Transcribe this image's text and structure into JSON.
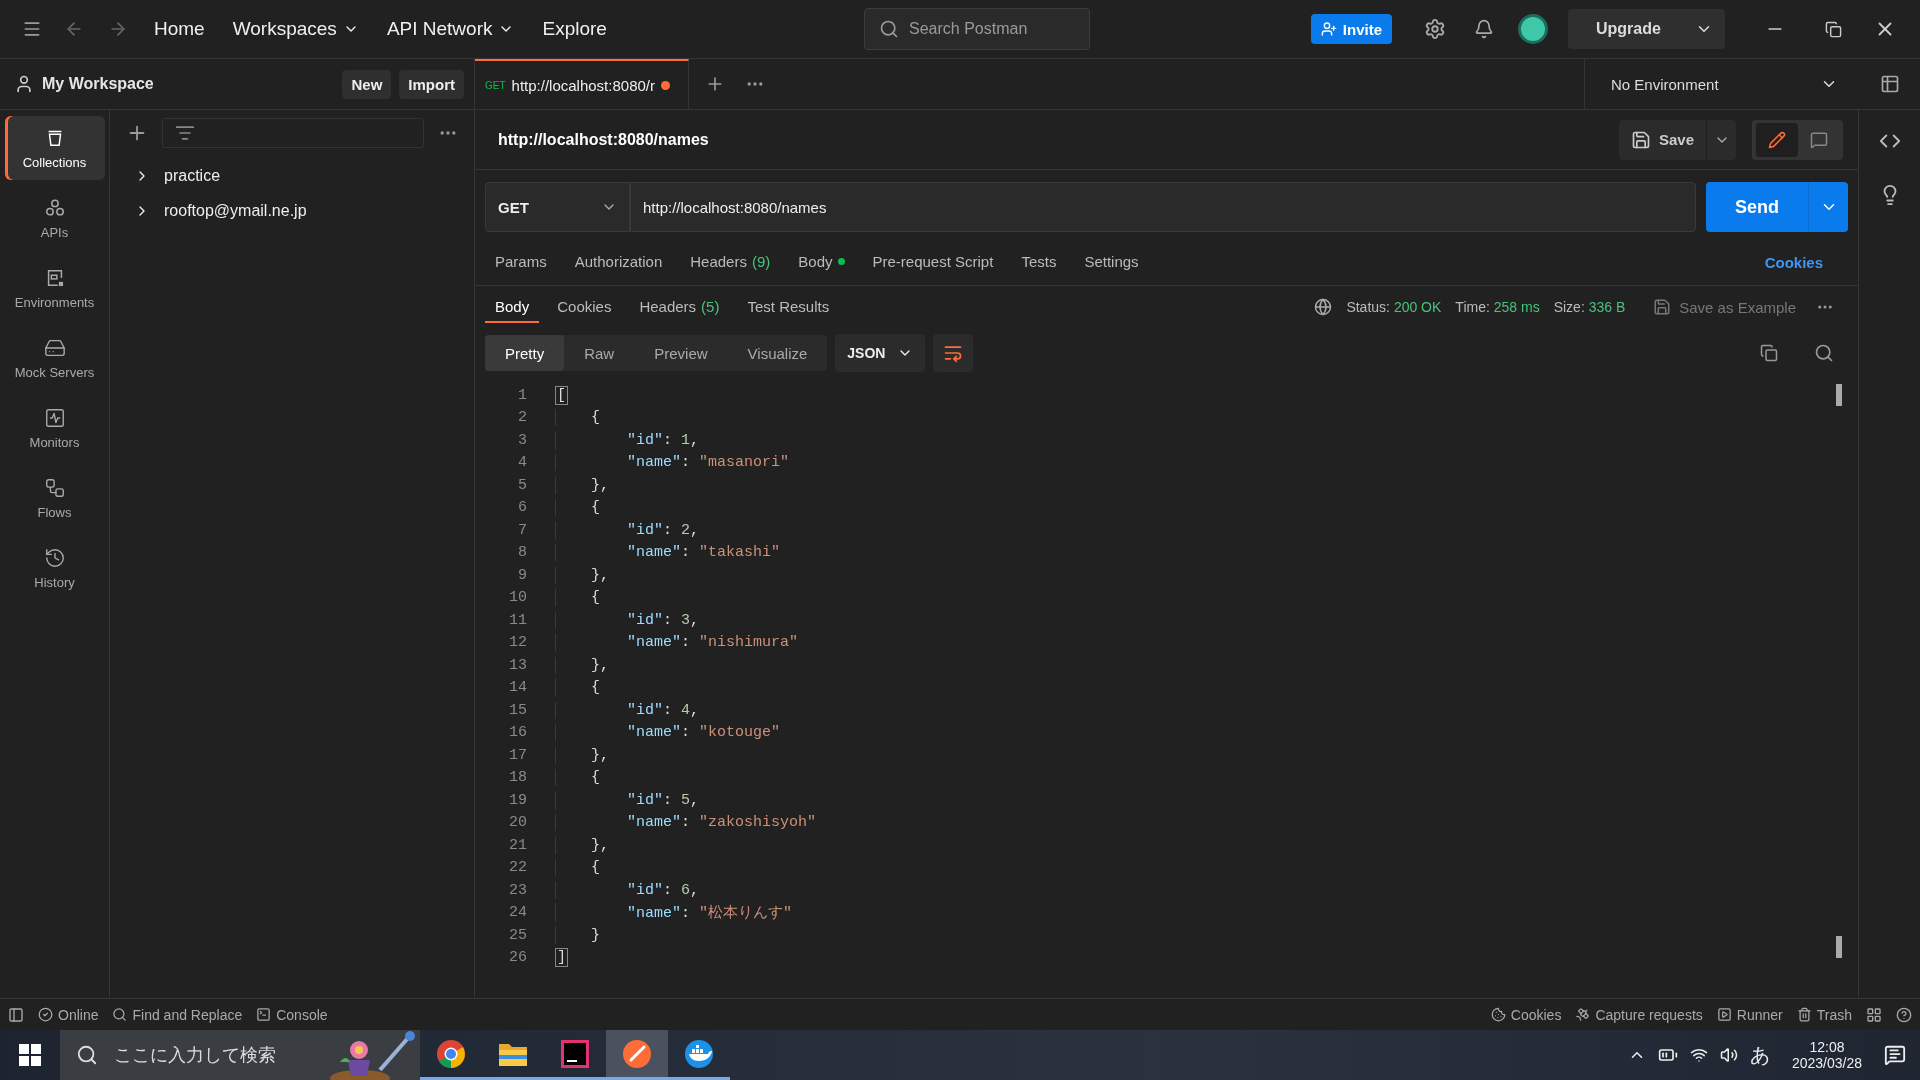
{
  "topbar": {
    "nav": [
      {
        "label": "Home",
        "dropdown": false
      },
      {
        "label": "Workspaces",
        "dropdown": true
      },
      {
        "label": "API Network",
        "dropdown": true
      },
      {
        "label": "Explore",
        "dropdown": false
      }
    ],
    "search_placeholder": "Search Postman",
    "invite": "Invite",
    "upgrade": "Upgrade"
  },
  "workspace": {
    "name": "My Workspace",
    "buttons": [
      "New",
      "Import"
    ]
  },
  "open_tabs": [
    {
      "method": "GET",
      "title": "http://localhost:8080/r",
      "unsaved": true,
      "selected": true
    }
  ],
  "environment": "No Environment",
  "rail": [
    {
      "kind": "collections",
      "label": "Collections",
      "selected": true
    },
    {
      "kind": "apis",
      "label": "APIs",
      "selected": false
    },
    {
      "kind": "environments",
      "label": "Environments",
      "selected": false
    },
    {
      "kind": "mock",
      "label": "Mock Servers",
      "selected": false
    },
    {
      "kind": "monitors",
      "label": "Monitors",
      "selected": false
    },
    {
      "kind": "flows",
      "label": "Flows",
      "selected": false
    },
    {
      "kind": "history",
      "label": "History",
      "selected": false
    }
  ],
  "collections": [
    {
      "name": "practice",
      "expanded": false
    },
    {
      "name": "rooftop@ymail.ne.jp",
      "expanded": false
    }
  ],
  "request": {
    "title": "http://localhost:8080/names",
    "save": "Save",
    "method": "GET",
    "url": "http://localhost:8080/names",
    "send": "Send",
    "modes": [
      {
        "kind": "edit",
        "selected": true
      },
      {
        "kind": "comments",
        "selected": false
      }
    ],
    "sections": [
      {
        "label": "Params",
        "selected": false
      },
      {
        "label": "Authorization",
        "selected": false
      },
      {
        "label": "Headers",
        "count": "(9)",
        "selected": false
      },
      {
        "label": "Body",
        "dot": true,
        "selected": false
      },
      {
        "label": "Pre-request Script",
        "selected": false
      },
      {
        "label": "Tests",
        "selected": false
      },
      {
        "label": "Settings",
        "selected": false
      }
    ],
    "cookies_link": "Cookies"
  },
  "response": {
    "tabs": [
      {
        "label": "Body",
        "selected": true
      },
      {
        "label": "Cookies",
        "selected": false
      },
      {
        "label": "Headers",
        "count": "(5)",
        "selected": false
      },
      {
        "label": "Test Results",
        "selected": false
      }
    ],
    "stats": [
      {
        "label": "Status:",
        "value": "200 OK"
      },
      {
        "label": "Time:",
        "value": "258 ms"
      },
      {
        "label": "Size:",
        "value": "336 B"
      }
    ],
    "save_example": {
      "label": "Save as Example",
      "disabled": true
    },
    "views": [
      {
        "label": "Pretty",
        "selected": true
      },
      {
        "label": "Raw",
        "selected": false
      },
      {
        "label": "Preview",
        "selected": false
      },
      {
        "label": "Visualize",
        "selected": false
      }
    ],
    "format": "JSON",
    "body": {
      "open": {
        "line": "1",
        "text": "[",
        "highlighted": true
      },
      "objects": [
        {
          "open": {
            "line": "2",
            "text": "{"
          },
          "fields": [
            {
              "line": "3",
              "tokens": [
                {
                  "kind": "key",
                  "text": "\"id\""
                },
                {
                  "kind": "colon",
                  "text": ":"
                },
                {
                  "kind": "number",
                  "text": "1"
                },
                {
                  "kind": "punct",
                  "text": ","
                }
              ]
            },
            {
              "line": "4",
              "tokens": [
                {
                  "kind": "key",
                  "text": "\"name\""
                },
                {
                  "kind": "colon",
                  "text": ":"
                },
                {
                  "kind": "string",
                  "text": "\"masanori\""
                }
              ]
            }
          ],
          "close": {
            "line": "5",
            "text": "},"
          }
        },
        {
          "open": {
            "line": "6",
            "text": "{"
          },
          "fields": [
            {
              "line": "7",
              "tokens": [
                {
                  "kind": "key",
                  "text": "\"id\""
                },
                {
                  "kind": "colon",
                  "text": ":"
                },
                {
                  "kind": "number",
                  "text": "2"
                },
                {
                  "kind": "punct",
                  "text": ","
                }
              ]
            },
            {
              "line": "8",
              "tokens": [
                {
                  "kind": "key",
                  "text": "\"name\""
                },
                {
                  "kind": "colon",
                  "text": ":"
                },
                {
                  "kind": "string",
                  "text": "\"takashi\""
                }
              ]
            }
          ],
          "close": {
            "line": "9",
            "text": "},"
          }
        },
        {
          "open": {
            "line": "10",
            "text": "{"
          },
          "fields": [
            {
              "line": "11",
              "tokens": [
                {
                  "kind": "key",
                  "text": "\"id\""
                },
                {
                  "kind": "colon",
                  "text": ":"
                },
                {
                  "kind": "number",
                  "text": "3"
                },
                {
                  "kind": "punct",
                  "text": ","
                }
              ]
            },
            {
              "line": "12",
              "tokens": [
                {
                  "kind": "key",
                  "text": "\"name\""
                },
                {
                  "kind": "colon",
                  "text": ":"
                },
                {
                  "kind": "string",
                  "text": "\"nishimura\""
                }
              ]
            }
          ],
          "close": {
            "line": "13",
            "text": "},"
          }
        },
        {
          "open": {
            "line": "14",
            "text": "{"
          },
          "fields": [
            {
              "line": "15",
              "tokens": [
                {
                  "kind": "key",
                  "text": "\"id\""
                },
                {
                  "kind": "colon",
                  "text": ":"
                },
                {
                  "kind": "number",
                  "text": "4"
                },
                {
                  "kind": "punct",
                  "text": ","
                }
              ]
            },
            {
              "line": "16",
              "tokens": [
                {
                  "kind": "key",
                  "text": "\"name\""
                },
                {
                  "kind": "colon",
                  "text": ":"
                },
                {
                  "kind": "string",
                  "text": "\"kotouge\""
                }
              ]
            }
          ],
          "close": {
            "line": "17",
            "text": "},"
          }
        },
        {
          "open": {
            "line": "18",
            "text": "{"
          },
          "fields": [
            {
              "line": "19",
              "tokens": [
                {
                  "kind": "key",
                  "text": "\"id\""
                },
                {
                  "kind": "colon",
                  "text": ":"
                },
                {
                  "kind": "number",
                  "text": "5"
                },
                {
                  "kind": "punct",
                  "text": ","
                }
              ]
            },
            {
              "line": "20",
              "tokens": [
                {
                  "kind": "key",
                  "text": "\"name\""
                },
                {
                  "kind": "colon",
                  "text": ":"
                },
                {
                  "kind": "string",
                  "text": "\"zakoshisyoh\""
                }
              ]
            }
          ],
          "close": {
            "line": "21",
            "text": "},"
          }
        },
        {
          "open": {
            "line": "22",
            "text": "{"
          },
          "fields": [
            {
              "line": "23",
              "tokens": [
                {
                  "kind": "key",
                  "text": "\"id\""
                },
                {
                  "kind": "colon",
                  "text": ":"
                },
                {
                  "kind": "number",
                  "text": "6"
                },
                {
                  "kind": "punct",
                  "text": ","
                }
              ]
            },
            {
              "line": "24",
              "tokens": [
                {
                  "kind": "key",
                  "text": "\"name\""
                },
                {
                  "kind": "colon",
                  "text": ":"
                },
                {
                  "kind": "string",
                  "text": "\"松本りんす\""
                }
              ]
            }
          ],
          "close": {
            "line": "25",
            "text": "}"
          }
        }
      ],
      "close": {
        "line": "26",
        "text": "]",
        "highlighted": true
      }
    }
  },
  "status_bar": {
    "left": [
      {
        "kind": "online",
        "label": "Online"
      },
      {
        "kind": "find",
        "label": "Find and Replace"
      },
      {
        "kind": "console",
        "label": "Console"
      }
    ],
    "right": [
      {
        "kind": "cookies",
        "label": "Cookies"
      },
      {
        "kind": "capture",
        "label": "Capture requests"
      },
      {
        "kind": "runner",
        "label": "Runner"
      },
      {
        "kind": "trash",
        "label": "Trash"
      }
    ]
  },
  "taskbar": {
    "search_placeholder": "ここに入力して検索",
    "apps": [
      {
        "kind": "chrome",
        "selected": false
      },
      {
        "kind": "explorer",
        "selected": false
      },
      {
        "kind": "intellij",
        "selected": false
      },
      {
        "kind": "postman",
        "selected": true
      },
      {
        "kind": "docker",
        "selected": false
      }
    ],
    "ime": "あ",
    "time": "12:08",
    "date": "2023/03/28"
  }
}
